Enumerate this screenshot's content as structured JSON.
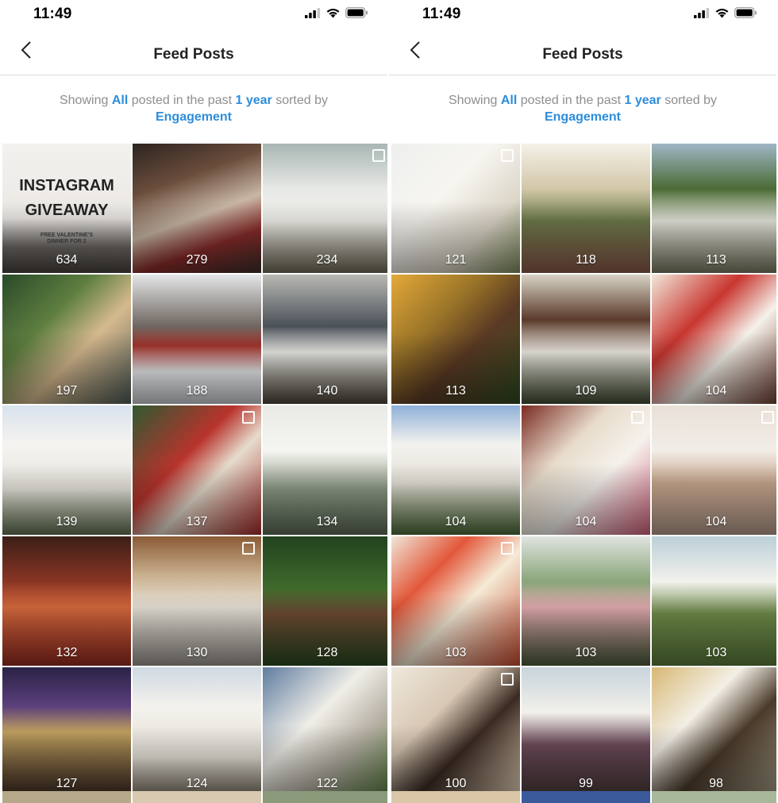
{
  "screens": [
    {
      "time": "11:49",
      "nav": {
        "title": "Feed Posts"
      },
      "filter": {
        "prefix": "Showing",
        "scope": "All",
        "middle": "posted in the past",
        "period": "1 year",
        "suffix": "sorted by",
        "sort": "Engagement"
      },
      "posts": [
        {
          "count": "634",
          "bg": "linear-gradient(180deg,#f3f1ee 0%,#ebe8e4 58%,#6f6a66 80%,#45403d 100%)",
          "multi": false,
          "giveaway": {
            "title_line1": "INSTAGRAM",
            "title_line2": "GIVEAWAY",
            "sub_line1": "FREE VALENTINE'S",
            "sub_line2": "DINNER FOR 2"
          }
        },
        {
          "count": "279",
          "bg": "linear-gradient(160deg,#2c2420 0%,#6b4d3c 30%,#c9b7a5 55%,#8a2c2a 75%,#3a2e2a 100%)",
          "multi": false
        },
        {
          "count": "234",
          "bg": "linear-gradient(180deg,#a9b6b3 0%,#e7e9e6 35%,#f2f1ec 60%,#6f6a55 100%)",
          "multi": true
        },
        {
          "count": "197",
          "bg": "linear-gradient(135deg,#2a4a2a 0%,#5d7e3f 35%,#d6b98e 60%,#4c5a56 100%)",
          "multi": false
        },
        {
          "count": "188",
          "bg": "linear-gradient(180deg,#e4e6e8 0%,#6e6660 40%,#a5332c 55%,#f1f2f3 75%,#c8ccd0 100%)",
          "multi": false
        },
        {
          "count": "140",
          "bg": "linear-gradient(180deg,#b9b9b3 0%,#4a5158 40%,#eeeeea 60%,#4b4437 100%)",
          "multi": false
        },
        {
          "count": "139",
          "bg": "linear-gradient(180deg,#d9e3ee 0%,#f4f3ef 30%,#e9e6de 65%,#617351 100%)",
          "multi": false
        },
        {
          "count": "137",
          "bg": "linear-gradient(135deg,#2f5a32 0%,#b8332c 40%,#e6dccd 60%,#a62b27 100%)",
          "multi": true
        },
        {
          "count": "134",
          "bg": "linear-gradient(180deg,#e9e9e5 0%,#f5f5f1 35%,#8e9a86 65%,#5c6b57 100%)",
          "multi": false
        },
        {
          "count": "132",
          "bg": "linear-gradient(180deg,#3b1f17 0%,#8a3524 35%,#d76a3e 55%,#962b21 100%)",
          "multi": false
        },
        {
          "count": "130",
          "bg": "linear-gradient(180deg,#8a5b36 0%,#c9b08e 30%,#e8e2d8 55%,#9a958e 100%)",
          "multi": true
        },
        {
          "count": "128",
          "bg": "linear-gradient(180deg,#23421e 0%,#3f6a2c 40%,#6e4a32 60%,#2b4a22 100%)",
          "multi": false
        },
        {
          "count": "127",
          "bg": "linear-gradient(180deg,#2a2346 0%,#5b3f7b 30%,#c0a060 50%,#3c2a22 100%)",
          "multi": false
        },
        {
          "count": "124",
          "bg": "linear-gradient(180deg,#cfd9e2 0%,#f3f1ec 30%,#e7e3da 70%,#7f7565 100%)",
          "multi": false
        },
        {
          "count": "122",
          "bg": "linear-gradient(135deg,#5f7ca0 0%,#f0eee8 40%,#b8b2a6 65%,#557a3c 100%)",
          "multi": false
        }
      ],
      "strip": [
        "#b5a98a",
        "#d8c9b0",
        "#8a9a7a"
      ]
    },
    {
      "time": "11:49",
      "nav": {
        "title": "Feed Posts"
      },
      "filter": {
        "prefix": "Showing",
        "scope": "All",
        "middle": "posted in the past",
        "period": "1 year",
        "suffix": "sorted by",
        "sort": "Engagement"
      },
      "posts": [
        {
          "count": "121",
          "bg": "linear-gradient(135deg,#eef0ee 0%,#f7f5f0 40%,#dcd6c8 70%,#7d8c5a 100%)",
          "multi": true
        },
        {
          "count": "118",
          "bg": "linear-gradient(180deg,#f4f1e8 0%,#d2c7a8 35%,#6c7a4a 60%,#8b5a4a 100%)",
          "multi": false
        },
        {
          "count": "113",
          "bg": "linear-gradient(180deg,#9fb6c5 0%,#4b6b35 35%,#e9e8df 60%,#7a7a62 100%)",
          "multi": false
        },
        {
          "count": "113",
          "bg": "linear-gradient(135deg,#e4a93a 0%,#9a7428 35%,#5a3a24 60%,#2f4a1f 100%)",
          "multi": false
        },
        {
          "count": "109",
          "bg": "linear-gradient(180deg,#d9d3c6 0%,#5a3a2a 35%,#f2eee6 60%,#3f4a30 100%)",
          "multi": false
        },
        {
          "count": "104",
          "bg": "linear-gradient(135deg,#f2e7da 0%,#c8362f 35%,#f5f1ea 60%,#6a3a2a 100%)",
          "multi": false
        },
        {
          "count": "104",
          "bg": "linear-gradient(180deg,#8fb0d8 0%,#f3f2ee 30%,#e6e2d8 60%,#4c6a38 100%)",
          "multi": false
        },
        {
          "count": "104",
          "bg": "linear-gradient(135deg,#7a2a22 0%,#e8dccb 35%,#f5f2ed 60%,#d25f7a 100%)",
          "multi": true
        },
        {
          "count": "104",
          "bg": "linear-gradient(180deg,#e9e1d8 0%,#f1ede7 35%,#c9a88e 60%,#b39a8a 100%)",
          "multi": true
        },
        {
          "count": "103",
          "bg": "linear-gradient(135deg,#f0e6d8 0%,#e2583a 30%,#f5ead6 55%,#c84a2e 100%)",
          "multi": true
        },
        {
          "count": "103",
          "bg": "linear-gradient(180deg,#dfe4e0 0%,#8aa57a 35%,#e3aab0 55%,#4a5a3a 100%)",
          "multi": false
        },
        {
          "count": "103",
          "bg": "linear-gradient(180deg,#bcd0d8 0%,#f2f1ec 35%,#6f8a4a 60%,#5a7a3a 100%)",
          "multi": false
        },
        {
          "count": "100",
          "bg": "linear-gradient(135deg,#efe8dc 0%,#d8c8b4 35%,#3a2a22 60%,#e6d2b8 100%)",
          "multi": true
        },
        {
          "count": "99",
          "bg": "linear-gradient(180deg,#c8d4dc 0%,#f2f0ea 35%,#6c4a5a 60%,#4a3a3a 100%)",
          "multi": false
        },
        {
          "count": "98",
          "bg": "linear-gradient(135deg,#d7b874 0%,#f3efe6 35%,#4a3a2a 60%,#a8a08a 100%)",
          "multi": false
        }
      ],
      "strip": [
        "#d9c7a8",
        "#3a5a9a",
        "#a8b89a"
      ]
    }
  ]
}
